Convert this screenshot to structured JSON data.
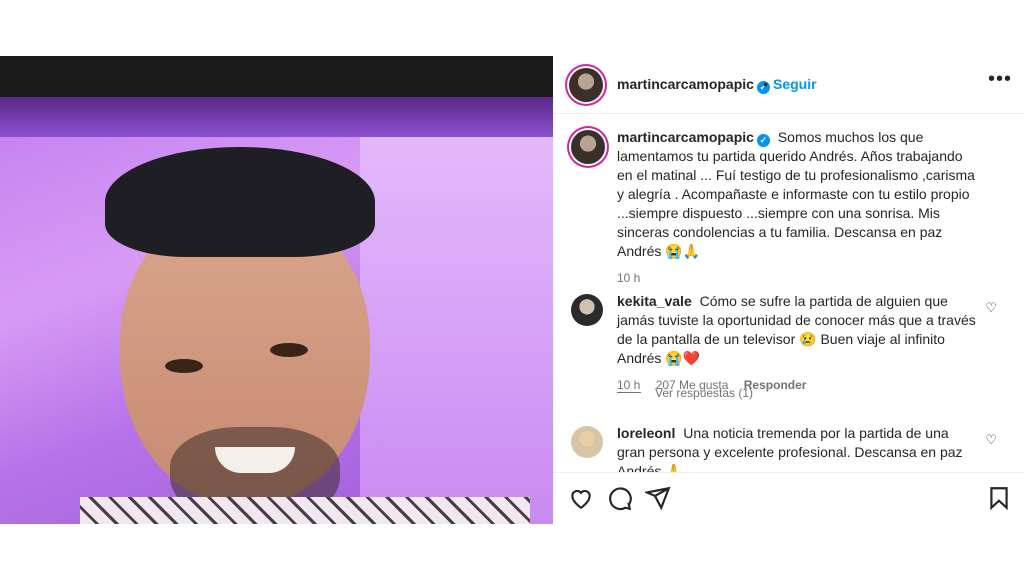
{
  "post": {
    "author": "martincarcamopapic",
    "separator": "•",
    "follow_label": "Seguir",
    "more_label": "•••",
    "caption": {
      "username": "martincarcamopapic",
      "text": "Somos muchos los que lamentamos tu partida querido Andrés. Años trabajando en el matinal ... Fuí testigo de tu profesionalismo ,carisma y alegría . Acompañaste e informaste con tu estilo propio ...siempre dispuesto ...siempre con una sonrisa. Mis sinceras condolencias a tu familia. Descansa en paz Andrés 😭🙏",
      "time": "10 h"
    },
    "comments": [
      {
        "username": "kekita_vale",
        "text": "Cómo se sufre la partida de alguien que jamás tuviste la oportunidad de conocer más que a través de la pantalla de un televisor 😢 Buen viaje al infinito Andrés 😭❤️",
        "time": "10 h",
        "likes": "207 Me gusta",
        "reply_label": "Responder",
        "view_replies": "Ver respuestas (1)"
      },
      {
        "username": "loreleonl",
        "text": "Una noticia tremenda por la partida de una gran persona y excelente profesional. Descansa en paz Andrés 🙏"
      }
    ],
    "icons": [
      "heart-icon",
      "comment-icon",
      "share-icon",
      "bookmark-icon"
    ]
  }
}
